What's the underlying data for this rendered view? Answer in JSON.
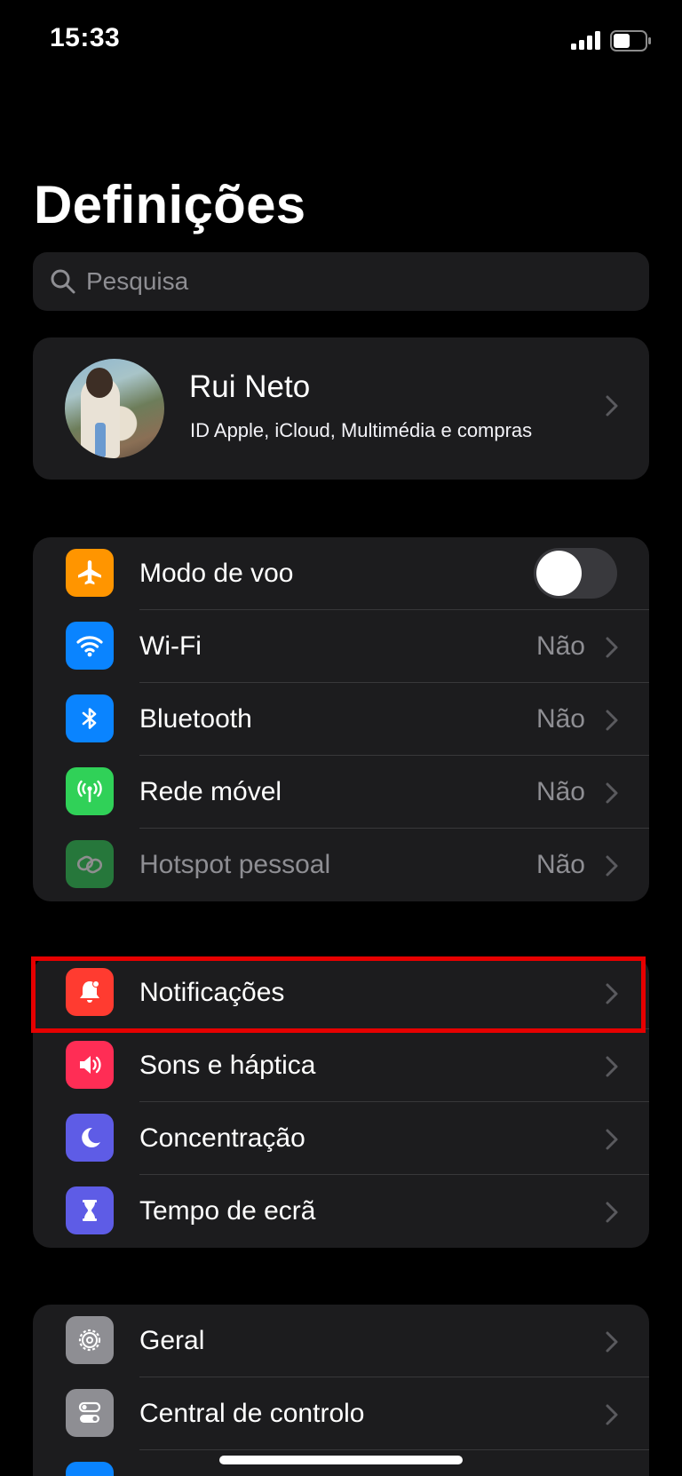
{
  "status_bar": {
    "time": "15:33",
    "signal_icon": "cellular-signal-icon",
    "battery_icon": "battery-icon"
  },
  "page": {
    "title": "Definições"
  },
  "search": {
    "placeholder": "Pesquisa",
    "icon": "search-icon"
  },
  "profile": {
    "name": "Rui Neto",
    "subtitle": "ID Apple, iCloud, Multimédia e compras"
  },
  "connectivity": [
    {
      "label": "Modo de voo",
      "icon": "airplane-icon",
      "color": "#ff9500",
      "toggle": false
    },
    {
      "label": "Wi-Fi",
      "value": "Não",
      "icon": "wifi-icon",
      "color": "#0a84ff"
    },
    {
      "label": "Bluetooth",
      "value": "Não",
      "icon": "bluetooth-icon",
      "color": "#0a84ff"
    },
    {
      "label": "Rede móvel",
      "value": "Não",
      "icon": "antenna-icon",
      "color": "#30d158"
    },
    {
      "label": "Hotspot pessoal",
      "value": "Não",
      "icon": "hotspot-icon",
      "color": "#30d158",
      "disabled": true
    }
  ],
  "notifications_group": [
    {
      "label": "Notificações",
      "icon": "bell-icon",
      "color": "#ff3b30"
    },
    {
      "label": "Sons e háptica",
      "icon": "speaker-icon",
      "color": "#ff2d55"
    },
    {
      "label": "Concentração",
      "icon": "moon-icon",
      "color": "#5e5ce6"
    },
    {
      "label": "Tempo de ecrã",
      "icon": "hourglass-icon",
      "color": "#5e5ce6"
    }
  ],
  "general_group": [
    {
      "label": "Geral",
      "icon": "gear-icon",
      "color": "#8e8e93"
    },
    {
      "label": "Central de controlo",
      "icon": "switches-icon",
      "color": "#8e8e93"
    }
  ],
  "highlight_color": "#e60000"
}
